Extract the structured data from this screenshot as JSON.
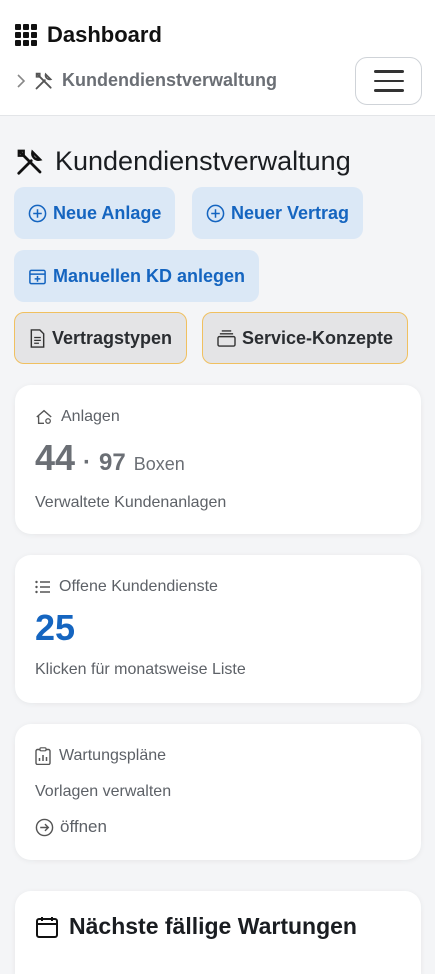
{
  "header": {
    "title": "Dashboard",
    "breadcrumb": "Kundendienstverwaltung"
  },
  "page": {
    "heading": "Kundendienstverwaltung"
  },
  "actions": {
    "new_asset": "Neue Anlage",
    "new_contract": "Neuer Vertrag",
    "manual_service": "Manuellen KD anlegen",
    "contract_types": "Vertragstypen",
    "service_concepts": "Service-Konzepte"
  },
  "cards": {
    "assets": {
      "label": "Anlagen",
      "count": "44",
      "separator": "·",
      "boxes_count": "97",
      "boxes_label": "Boxen",
      "description": "Verwaltete Kundenanlagen"
    },
    "open_services": {
      "label": "Offene Kundendienste",
      "count": "25",
      "description": "Klicken für monatsweise Liste"
    },
    "maintenance_plans": {
      "label": "Wartungspläne",
      "description": "Vorlagen verwalten",
      "open_label": "öffnen"
    },
    "next_due": {
      "title": "Nächste fällige Wartungen"
    }
  },
  "colors": {
    "accent_blue": "#1565c0",
    "button_blue_bg": "#dbe8f6",
    "button_gray_border": "#f0c060"
  },
  "icons": [
    "grid-icon",
    "chevron-right-icon",
    "tools-icon",
    "hamburger-icon",
    "plus-circle-icon",
    "calendar-plus-icon",
    "document-icon",
    "stack-icon",
    "house-gear-icon",
    "list-icon",
    "clipboard-chart-icon",
    "arrow-circle-right-icon",
    "calendar-icon"
  ]
}
